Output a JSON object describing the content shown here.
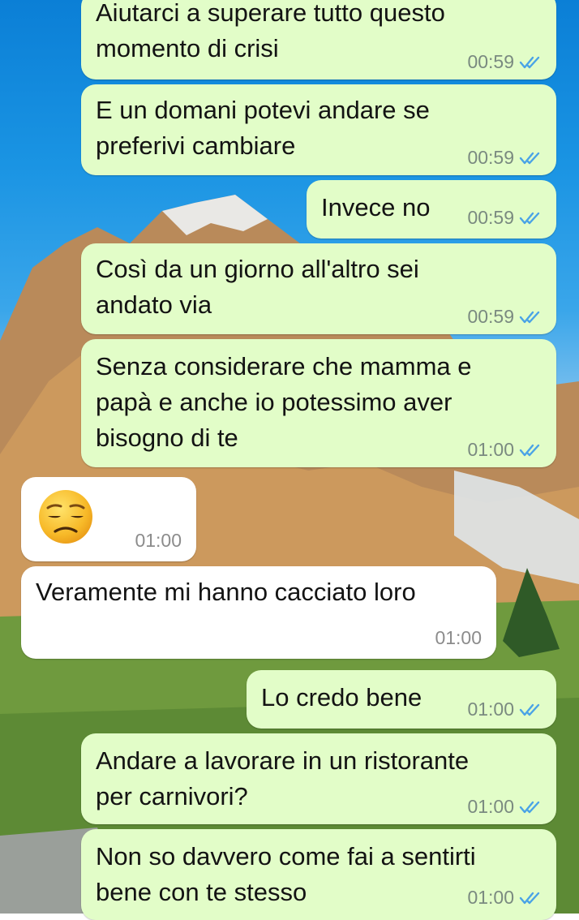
{
  "colors": {
    "outgoing_bubble": "#e2fdc8",
    "incoming_bubble": "#ffffff",
    "read_ticks": "#4aa3e6",
    "time_text": "#7a8a80"
  },
  "messages": [
    {
      "id": "m1",
      "direction": "outgoing",
      "text": "Aiutarci a superare tutto questo\nmomento di crisi",
      "time": "00:59",
      "status": "read-ticks-icon"
    },
    {
      "id": "m2",
      "direction": "outgoing",
      "text": "E un domani potevi andare se\npreferivi cambiare",
      "time": "00:59",
      "status": "read-ticks-icon"
    },
    {
      "id": "m3",
      "direction": "outgoing",
      "text": "Invece no",
      "time": "00:59",
      "status": "read-ticks-icon"
    },
    {
      "id": "m4",
      "direction": "outgoing",
      "text": "Così da un giorno all'altro sei\nandato via",
      "time": "00:59",
      "status": "read-ticks-icon"
    },
    {
      "id": "m5",
      "direction": "outgoing",
      "text": "Senza considerare che mamma e\npapà e anche io potessimo aver\nbisogno di te",
      "time": "01:00",
      "status": "read-ticks-icon"
    },
    {
      "id": "m6",
      "direction": "incoming",
      "emoji": "unamused-face-emoji",
      "time": "01:00"
    },
    {
      "id": "m7",
      "direction": "incoming",
      "text": "Veramente mi hanno cacciato loro",
      "time": "01:00"
    },
    {
      "id": "m8",
      "direction": "outgoing",
      "text": "Lo credo bene",
      "time": "01:00",
      "status": "read-ticks-icon"
    },
    {
      "id": "m9",
      "direction": "outgoing",
      "text": "Andare a lavorare in un ristorante\nper carnivori?",
      "time": "01:00",
      "status": "read-ticks-icon"
    },
    {
      "id": "m10",
      "direction": "outgoing",
      "text": "Non so davvero come fai a sentirti\nbene con te stesso",
      "time": "01:00",
      "status": "read-ticks-icon"
    }
  ]
}
